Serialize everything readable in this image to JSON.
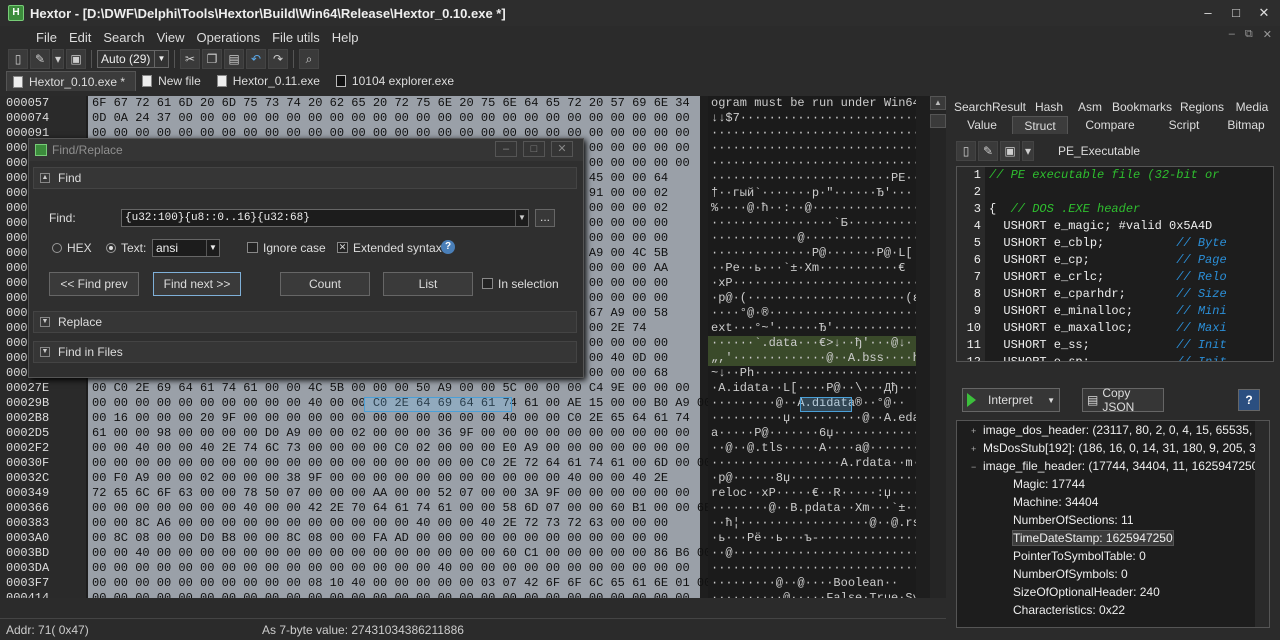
{
  "window": {
    "title": "Hextor - [D:\\DWF\\Delphi\\Tools\\Hextor\\Build\\Win64\\Release\\Hextor_0.10.exe *]",
    "min": "–",
    "max": "□",
    "close": "✕"
  },
  "menu": [
    "File",
    "Edit",
    "Search",
    "View",
    "Operations",
    "File utils",
    "Help"
  ],
  "toolbar": {
    "encoding": "Auto (29)"
  },
  "file_tabs": [
    "Hextor_0.10.exe *",
    "New file",
    "Hextor_0.11.exe",
    "10104 explorer.exe"
  ],
  "offsets": [
    "000057",
    "000074",
    "000091",
    "0000AE",
    "0000CB",
    "0000E8",
    "000105",
    "000122",
    "00013F",
    "00015C",
    "000179",
    "000196",
    "0001B3",
    "0001D0",
    "0001ED",
    "00020A",
    "000227",
    "000244",
    "000261",
    "00027E",
    "00029B",
    "0002B8",
    "0002D5",
    "0002F2",
    "00030F",
    "00032C",
    "000349",
    "000366",
    "000383",
    "0003A0",
    "0003BD",
    "0003DA",
    "0003F7",
    "000414"
  ],
  "hex_rows": [
    "6F 67 72 61 6D 20 6D 75 73 74 20 62 65 20 72 75 6E 20 75 6E 64 65 72 20 57 69 6E 34",
    "0D 0A 24 37 00 00 00 00 00 00 00 00 00 00 00 00 00 00 00 00 00 00 00 00 00 00 00 00",
    "00 00 00 00 00 00 00 00 00 00 00 00 00 00 00 00 00 00 00 00 00 00 00 00 00 00 00 00",
    "00 00 00 00 00 00 00 00 00 00 00 00 00 00 00 00 00 00 00 00 00 00 00 00 00 00 00 00",
    "00 00 00 00 00 00 00 00 00 00 00 00 00 00 00 00 00 00 00 00 00 00 00 00 00 00 00 00",
    "00 00 00 00 00 00 00 00 00 00 00 00 00 00 00 00 00 00 00 00 00 00 50 45 00 00 64",
    "00 00 00 00 00 00 00 00 00 00 00 00 00 00 00 00 00 00 00 00 00 00 80 91 00 00 02",
    "00 00 00 00 00 00 00 00 00 00 00 00 00 00 00 00 00 00 00 00 00 00 00 00 00 00 02",
    "00 00 00 00 00 00 00 00 00 00 00 00 00 00 00 00 00 00 00 00 00 00 00 00 00 00 00",
    "00 00 00 00 00 00 00 00 00 00 00 00 00 00 00 00 00 00 00 00 00 00 00 00 00 00 00",
    "00 00 00 00 00 00 00 00 00 00 00 00 00 00 00 00 00 00 00 00 00 00 50 A9 00 4C 5B",
    "00 00 00 00 00 00 00 00 00 00 00 00 00 00 00 00 00 00 00 00 00 00 00 00 00 00 AA",
    "00 00 00 00 00 00 00 00 00 00 00 00 00 00 00 00 00 00 00 00 00 00 00 00 00 00 00",
    "00 00 00 00 00 00 00 00 00 00 00 00 00 00 00 00 00 00 00 00 00 00 00 00 00 00 00",
    "00 00 00 00 00 00 00 00 00 00 00 00 00 00 00 00 00 00 00 00 00 00 28 67 A9 00 58",
    "00 00 00 00 00 00 00 00 00 00 00 00 00 00 00 00 00 00 00 00 00 00 00 00 2E 74",
    "00 00 00 00 00 00 00 00 00 00 00 00 00 00 00 00 00 00 00 00 00 00 00 00 00 00 00",
    "00 00 00 00 00 00 00 00 00 00 00 00 00 00 00 00 00 00 00 00 00 00 00 00 40 0D 00",
    "00 00 00 00 00 00 00 00 00 00 00 00 00 00 00 00 00 00 00 00 00 00 00 00 00 00 68",
    "00 C0 2E 69 64 61 74 61 00 00 4C 5B 00 00 00 50 A9 00 00 5C 00 00 00 C4 9E 00 00 00",
    "00 00 00 00 00 00 00 00 00 00 40 00 00 C0 2E 64 69 64 61 74 61 00 AE 15 00 00 B0 A9 00",
    "00 16 00 00 00 20 9F 00 00 00 00 00 00 00 00 00 00 00 00 40 00 00 C0 2E 65 64 61 74",
    "61 00 00 98 00 00 00 00 D0 A9 00 00 02 00 00 00 36 9F 00 00 00 00 00 00 00 00 00 00",
    "00 00 40 00 00 40 2E 74 6C 73 00 00 00 00 C0 02 00 00 00 E0 A9 00 00 00 00 00 00 00",
    "00 00 00 00 00 00 00 00 00 00 00 00 00 00 00 00 00 00 C0 2E 72 64 61 74 61 00 6D 00 00 00",
    "00 F0 A9 00 00 02 00 00 00 38 9F 00 00 00 00 00 00 00 00 00 00 00 40 00 00 40 2E",
    "72 65 6C 6F 63 00 00 78 50 07 00 00 00 AA 00 00 52 07 00 00 3A 9F 00 00 00 00 00 00",
    "00 00 00 00 00 00 00 40 00 00 42 2E 70 64 61 74 61 00 00 58 6D 07 00 00 60 B1 00 00 6E 07",
    "00 00 8C A6 00 00 00 00 00 00 00 00 00 00 00 40 00 00 40 2E 72 73 72 63 00 00 00",
    "00 8C 08 00 00 D0 B8 00 00 8C 08 00 00 FA AD 00 00 00 00 00 00 00 00 00 00 00 00",
    "00 00 40 00 00 00 00 00 00 00 00 00 00 00 00 00 00 00 00 60 C1 00 00 00 00 00 86 B6 00 00",
    "00 00 00 00 00 00 00 00 00 00 00 00 00 00 00 00 40 00 00 00 00 00 00 00 00 00 00 00",
    "00 00 00 00 00 00 00 00 00 00 08 10 40 00 00 00 00 00 03 07 42 6F 6F 6C 65 61 6E 01 00 00",
    "00 00 00 00 00 00 00 00 00 00 00 00 00 00 00 00 00 00 00 00 00 00 00 00 00 00 00 00"
  ],
  "text_rows": [
    "ogram must be run under Win64",
    "↓↓$7···························",
    "································",
    "································",
    "································",
    "·························PE··d",
    "†··гый`·······p·\"······Ђ'···",
    "%····@·ћ··:··@·················",
    "·················`Б··············",
    "············@·················",
    "··············P@·······P@·L[",
    "··Pe··ь···`±·Xm···········€",
    "·xP·····························",
    "·p@·(······················(ε@·X",
    "····°@·®························",
    "ext···°~'······Ђ'·············",
    "······`.data···€>↓··ђ'···@↓·",
    "„,'·············@··A.bss····h",
    "~↓··Ph························",
    "·A.idata··L[····P@··\\···Дђ····",
    "·········@··A.didata®··°@··",
    "··········џ··········@··A.edat",
    "a·····P@·······6џ·············",
    "··@··@.tls·····A····a@········",
    "··················A.rdata··m···",
    "·p@······8џ··················@··@.",
    "reloc··xP·····€··R·····:џ······",
    "········@··B.pdata··Xm···`±···n·",
    "··ћ¦··················@··@.rsrc··",
    "·ь···Рё··ь···ъ-····················",
    "··@···························`Б······†¶",
    "·····························@·····",
    "·········@··@····Boolean··",
    "··········@·····False·True·Sys"
  ],
  "find_dialog": {
    "title": "Find/Replace",
    "find_section": "Find",
    "find_label": "Find:",
    "find_value": "{u32:100}{u8::0..16}{u32:68}",
    "more": "...",
    "hex_label": "HEX",
    "text_label": "Text:",
    "charset": "ansi",
    "ignore_case": "Ignore case",
    "extended_syntax": "Extended syntax",
    "extended_checked": "✕",
    "find_prev": "<< Find prev",
    "find_next": "Find next >>",
    "count": "Count",
    "list": "List",
    "in_selection": "In selection",
    "replace_section": "Replace",
    "find_in_files_section": "Find in Files"
  },
  "right_tabs_row1": [
    "SearchResult",
    "Hash",
    "Asm",
    "Bookmarks",
    "Regions",
    "Media"
  ],
  "right_tabs_row2": [
    "Value",
    "Struct",
    "Compare",
    "Script",
    "Bitmap"
  ],
  "struct_name": "PE_Executable",
  "code_lines": [
    {
      "n": "1",
      "a": "",
      "b": "// PE executable file (32-bit or"
    },
    {
      "n": "2",
      "a": "",
      "b": ""
    },
    {
      "n": "3",
      "a": "{  ",
      "b": "// DOS .EXE header"
    },
    {
      "n": "4",
      "a": "  USHORT e_magic; #valid 0x5A4D",
      "b": ""
    },
    {
      "n": "5",
      "a": "  USHORT e_cblp;          ",
      "b": "// Byte"
    },
    {
      "n": "6",
      "a": "  USHORT e_cp;            ",
      "b": "// Page"
    },
    {
      "n": "7",
      "a": "  USHORT e_crlc;          ",
      "b": "// Relo"
    },
    {
      "n": "8",
      "a": "  USHORT e_cparhdr;       ",
      "b": "// Size"
    },
    {
      "n": "9",
      "a": "  USHORT e_minalloc;      ",
      "b": "// Mini"
    },
    {
      "n": "10",
      "a": "  USHORT e_maxalloc;      ",
      "b": "// Maxi"
    },
    {
      "n": "11",
      "a": "  USHORT e_ss;            ",
      "b": "// Init"
    },
    {
      "n": "12",
      "a": "  USHORT e_sp;            ",
      "b": "// Init"
    }
  ],
  "interpret": "Interpret",
  "copy_json": "Copy JSON",
  "help": "?",
  "tree": [
    {
      "indent": 1,
      "tw": "+",
      "text": "image_dos_header: (23117, 80, 2, 0, 4, 15, 65535, 0,"
    },
    {
      "indent": 1,
      "tw": "+",
      "text": "MsDosStub[192]: (186, 16, 0, 14, 31, 180, 9, 205, 33,"
    },
    {
      "indent": 1,
      "tw": "−",
      "text": "image_file_header: (17744, 34404, 11, 1625947250, 0,"
    },
    {
      "indent": 2,
      "tw": "",
      "text": "Magic: 17744"
    },
    {
      "indent": 2,
      "tw": "",
      "text": "Machine: 34404"
    },
    {
      "indent": 2,
      "tw": "",
      "text": "NumberOfSections: 11"
    },
    {
      "indent": 2,
      "tw": "",
      "text": "TimeDateStamp: 1625947250",
      "sel": true
    },
    {
      "indent": 2,
      "tw": "",
      "text": "PointerToSymbolTable: 0"
    },
    {
      "indent": 2,
      "tw": "",
      "text": "NumberOfSymbols: 0"
    },
    {
      "indent": 2,
      "tw": "",
      "text": "SizeOfOptionalHeader: 240"
    },
    {
      "indent": 2,
      "tw": "",
      "text": "Characteristics: 0x22"
    }
  ],
  "status": {
    "addr": "Addr: 71( 0x47)",
    "value": "As 7-byte value: 27431034386211886"
  }
}
